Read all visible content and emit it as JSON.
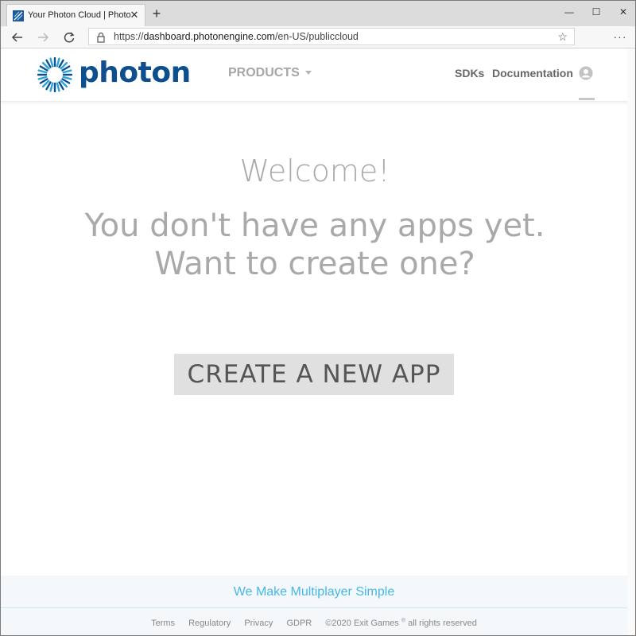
{
  "browser": {
    "tab_title": "Your Photon Cloud | Photon Engine",
    "tab_close": "✕",
    "new_tab": "+",
    "url_scheme": "https://",
    "url_domain": "dashboard.photonengine.com",
    "url_path": "/en-US/publiccloud",
    "window_min": "—",
    "window_max": "☐",
    "window_close": "✕"
  },
  "header": {
    "logo_text": "photon",
    "products_label": "PRODUCTS",
    "nav": [
      "SDKs",
      "Documentation"
    ]
  },
  "main": {
    "welcome": "Welcome!",
    "line1": "You don't have any apps yet.",
    "line2": "Want to create one?",
    "create_button": "CREATE A NEW APP"
  },
  "footer": {
    "tagline": "We Make Multiplayer Simple",
    "links": [
      "Terms",
      "Regulatory",
      "Privacy",
      "GDPR"
    ],
    "copyright": "©2020 Exit Games",
    "registered": "®",
    "rights": "all rights reserved"
  },
  "colors": {
    "brand": "#0e4f8e",
    "tagline": "#43b8e6",
    "button_bg": "#e0e0e0"
  }
}
